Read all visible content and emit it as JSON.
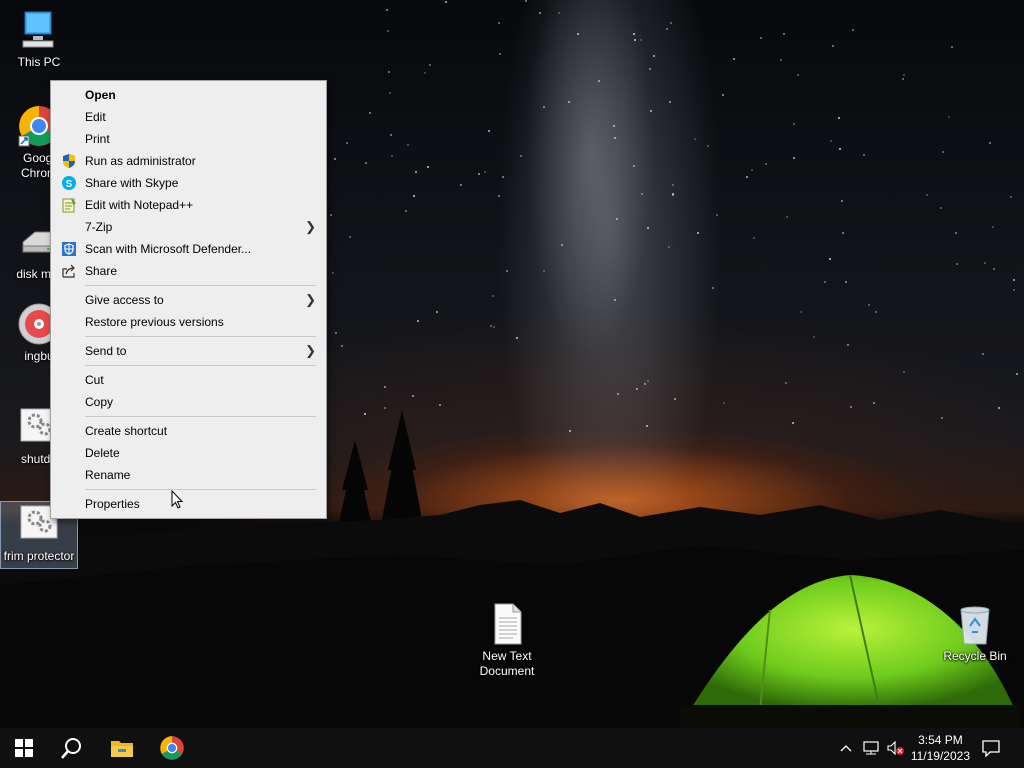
{
  "desktop": {
    "icons": [
      {
        "label": "This PC",
        "icon": "this-pc-icon"
      },
      {
        "label": "Googl\nChrom",
        "icon": "chrome-icon"
      },
      {
        "label": "disk mar",
        "icon": "disk-management-icon"
      },
      {
        "label": "ingbu",
        "icon": "cd-burner-icon"
      },
      {
        "label": "shutdo",
        "icon": "shortcut-gear-icon"
      },
      {
        "label": "frim protector",
        "icon": "shortcut-gear-icon"
      },
      {
        "label": "New Text\nDocument",
        "icon": "text-document-icon"
      },
      {
        "label": "Recycle Bin",
        "icon": "recycle-bin-icon"
      }
    ]
  },
  "context_menu": {
    "items": [
      {
        "label": "Open",
        "bold": true
      },
      {
        "label": "Edit"
      },
      {
        "label": "Print"
      },
      {
        "label": "Run as administrator",
        "icon": "uac-shield-icon"
      },
      {
        "label": "Share with Skype",
        "icon": "skype-icon"
      },
      {
        "label": "Edit with Notepad++",
        "icon": "notepadpp-icon"
      },
      {
        "label": "7-Zip",
        "submenu": true
      },
      {
        "label": "Scan with Microsoft Defender...",
        "icon": "defender-icon"
      },
      {
        "label": "Share",
        "icon": "share-icon"
      },
      {
        "label": "Give access to",
        "submenu": true
      },
      {
        "label": "Restore previous versions"
      },
      {
        "label": "Send to",
        "submenu": true
      },
      {
        "label": "Cut"
      },
      {
        "label": "Copy"
      },
      {
        "label": "Create shortcut"
      },
      {
        "label": "Delete"
      },
      {
        "label": "Rename"
      },
      {
        "label": "Properties"
      }
    ]
  },
  "taskbar": {
    "start": "start-icon",
    "search": "search-icon",
    "pinned": [
      "file-explorer-icon",
      "chrome-icon"
    ],
    "tray": {
      "icons": [
        "chevron-up-icon",
        "network-icon",
        "volume-muted-icon"
      ],
      "time": "3:54 PM",
      "date": "11/19/2023",
      "notification": "action-center-icon"
    }
  },
  "colors": {
    "menu_bg": "#eeeeee",
    "taskbar_bg": "#101010",
    "chrome_red": "#db4437",
    "chrome_green": "#0f9d58",
    "chrome_yellow": "#f4b400",
    "chrome_blue": "#4285f4"
  }
}
